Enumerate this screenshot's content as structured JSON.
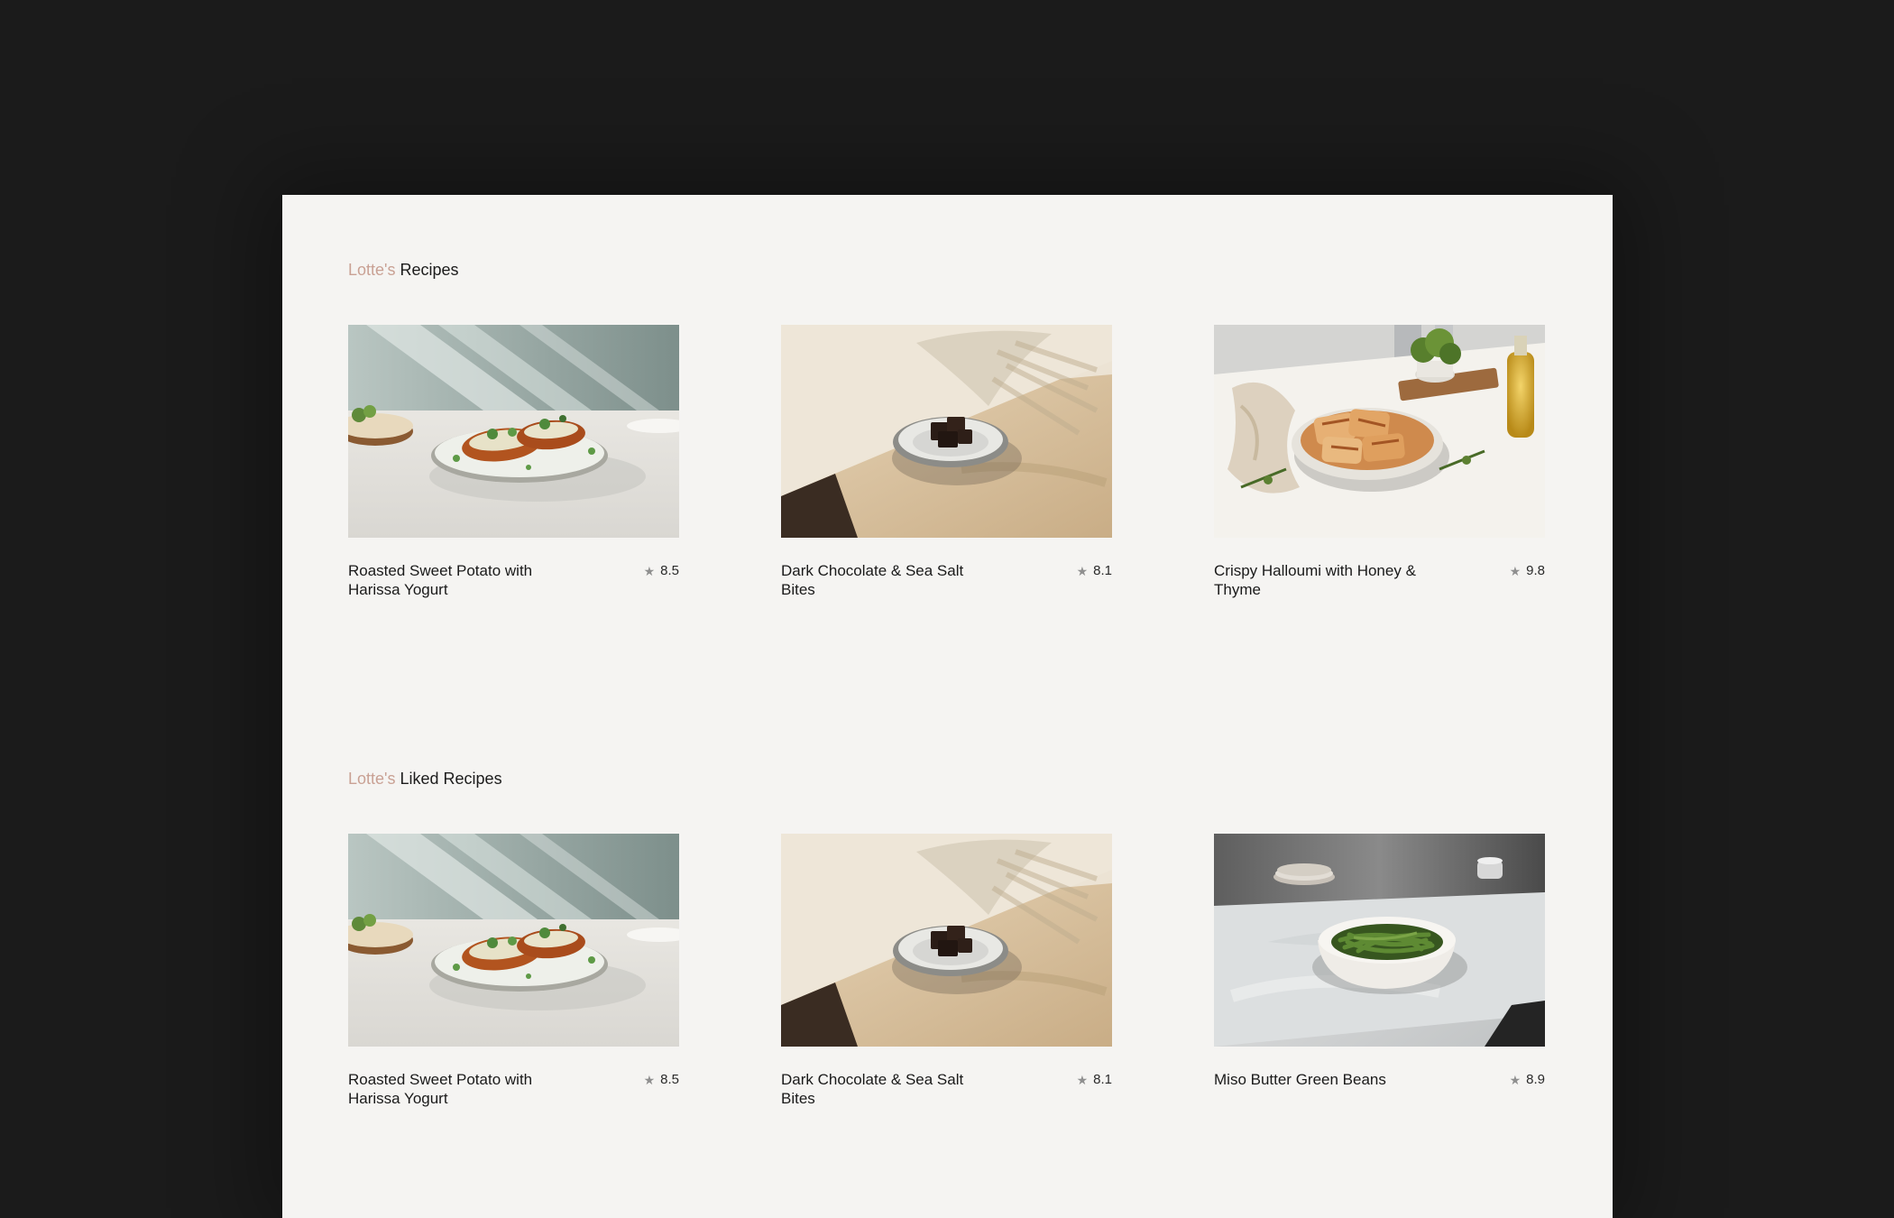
{
  "sections": {
    "recipes": {
      "owner": "Lotte's",
      "title": "Recipes",
      "cards": [
        {
          "title": "Roasted Sweet Potato with Harissa Yogurt",
          "rating": "8.5",
          "image": "sweet-potato"
        },
        {
          "title": "Dark Chocolate & Sea Salt Bites",
          "rating": "8.1",
          "image": "chocolate-bites"
        },
        {
          "title": "Crispy Halloumi with Honey & Thyme",
          "rating": "9.8",
          "image": "halloumi"
        }
      ]
    },
    "liked": {
      "owner": "Lotte's",
      "title": "Liked Recipes",
      "cards": [
        {
          "title": "Roasted Sweet Potato with Harissa Yogurt",
          "rating": "8.5",
          "image": "sweet-potato"
        },
        {
          "title": "Dark Chocolate & Sea Salt Bites",
          "rating": "8.1",
          "image": "chocolate-bites"
        },
        {
          "title": "Miso Butter Green Beans",
          "rating": "8.9",
          "image": "green-beans"
        }
      ]
    }
  },
  "icons": {
    "star": "star-icon"
  },
  "colors": {
    "background": "#1b1b1b",
    "panel": "#f5f4f2",
    "owner_accent": "#c9a194",
    "text": "#1a1a1a",
    "star": "#8f8f8f"
  }
}
